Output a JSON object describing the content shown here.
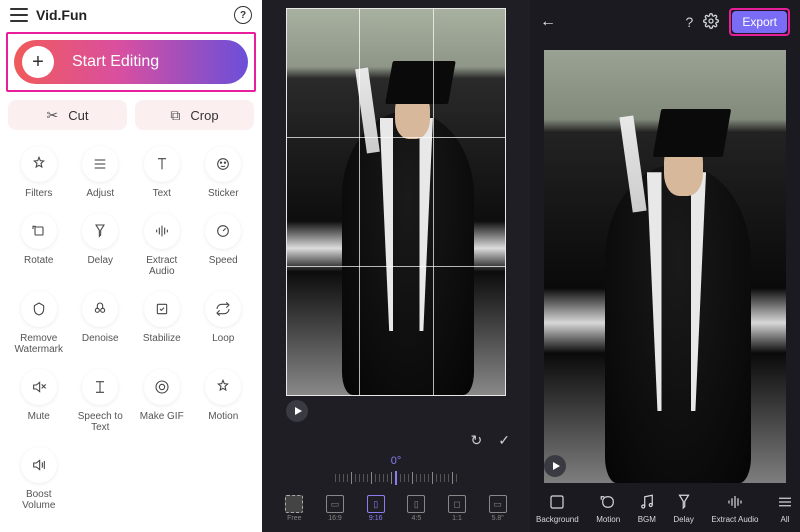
{
  "app": {
    "title": "Vid.Fun"
  },
  "start": {
    "label": "Start Editing"
  },
  "cutcrop": {
    "cut": "Cut",
    "crop": "Crop"
  },
  "tools": [
    {
      "id": "filters",
      "label": "Filters"
    },
    {
      "id": "adjust",
      "label": "Adjust"
    },
    {
      "id": "text",
      "label": "Text"
    },
    {
      "id": "sticker",
      "label": "Sticker"
    },
    {
      "id": "rotate",
      "label": "Rotate"
    },
    {
      "id": "delay",
      "label": "Delay"
    },
    {
      "id": "extract-audio",
      "label": "Extract Audio"
    },
    {
      "id": "speed",
      "label": "Speed"
    },
    {
      "id": "remove-watermark",
      "label": "Remove Watermark"
    },
    {
      "id": "denoise",
      "label": "Denoise"
    },
    {
      "id": "stabilize",
      "label": "Stabilize"
    },
    {
      "id": "loop",
      "label": "Loop"
    },
    {
      "id": "mute",
      "label": "Mute"
    },
    {
      "id": "speech-to-text",
      "label": "Speech to Text"
    },
    {
      "id": "make-gif",
      "label": "Make GIF"
    },
    {
      "id": "motion",
      "label": "Motion"
    },
    {
      "id": "boost-volume",
      "label": "Boost Volume"
    }
  ],
  "crop": {
    "rotation_angle": "0°",
    "aspects": [
      {
        "id": "free",
        "label": "Free",
        "icon": ""
      },
      {
        "id": "16-9",
        "label": "16:9",
        "icon": "▭"
      },
      {
        "id": "9-16",
        "label": "9:16",
        "icon": "▯",
        "active": true,
        "brand": "tiktok"
      },
      {
        "id": "4-5",
        "label": "4:5",
        "icon": "▯",
        "brand": "instagram"
      },
      {
        "id": "1-1",
        "label": "1:1",
        "icon": "◻",
        "brand": "instagram"
      },
      {
        "id": "5-8",
        "label": "5.8\"",
        "icon": "▭",
        "brand": "apple"
      }
    ]
  },
  "right": {
    "export": "Export",
    "tools": [
      {
        "id": "background",
        "label": "Background"
      },
      {
        "id": "motion",
        "label": "Motion"
      },
      {
        "id": "bgm",
        "label": "BGM"
      },
      {
        "id": "delay",
        "label": "Delay"
      },
      {
        "id": "extract-audio",
        "label": "Extract Audio"
      },
      {
        "id": "all",
        "label": "All"
      }
    ]
  }
}
